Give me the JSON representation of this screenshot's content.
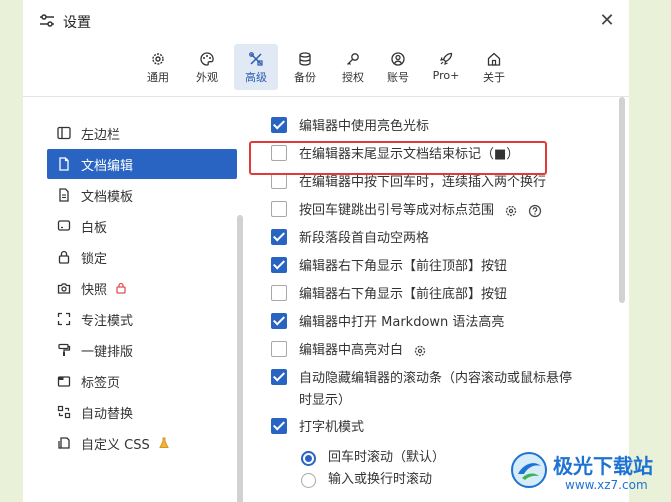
{
  "window": {
    "title": "设置"
  },
  "tabs": [
    {
      "label": "通用",
      "icon": "gear-icon"
    },
    {
      "label": "外观",
      "icon": "palette-icon"
    },
    {
      "label": "高级",
      "icon": "tools-icon",
      "active": true
    },
    {
      "label": "备份",
      "icon": "database-icon"
    },
    {
      "label": "授权",
      "icon": "key-icon"
    },
    {
      "label": "账号",
      "icon": "user-icon"
    },
    {
      "label": "Pro+",
      "icon": "rocket-icon"
    },
    {
      "label": "关于",
      "icon": "home-icon"
    }
  ],
  "sidebar": {
    "items": [
      {
        "label": "左边栏",
        "icon": "sidebar-icon"
      },
      {
        "label": "文档编辑",
        "icon": "document-icon",
        "active": true
      },
      {
        "label": "文档模板",
        "icon": "template-icon"
      },
      {
        "label": "白板",
        "icon": "whiteboard-icon"
      },
      {
        "label": "锁定",
        "icon": "lock-icon"
      },
      {
        "label": "快照",
        "icon": "camera-icon",
        "badge": "lock-badge-icon"
      },
      {
        "label": "专注模式",
        "icon": "focus-icon"
      },
      {
        "label": "一键排版",
        "icon": "brush-icon"
      },
      {
        "label": "标签页",
        "icon": "tab-icon"
      },
      {
        "label": "自动替换",
        "icon": "replace-icon"
      },
      {
        "label": "自定义 CSS",
        "icon": "css-icon",
        "badge": "flask-icon"
      }
    ]
  },
  "options": [
    {
      "label": "编辑器中使用亮色光标",
      "checked": true
    },
    {
      "label": "在编辑器末尾显示文档结束标记（■）",
      "checked": false
    },
    {
      "label": "在编辑器中按下回车时，连续插入两个换行",
      "checked": false
    },
    {
      "label": "按回车键跳出引号等成对标点范围",
      "checked": false
    },
    {
      "label": "新段落段首自动空两格",
      "checked": true
    },
    {
      "label": "编辑器右下角显示【前往顶部】按钮",
      "checked": true
    },
    {
      "label": "编辑器右下角显示【前往底部】按钮",
      "checked": false
    },
    {
      "label": "编辑器中打开 Markdown 语法高亮",
      "checked": true
    },
    {
      "label": "编辑器中高亮对白",
      "checked": false
    },
    {
      "label": "自动隐藏编辑器的滚动条（内容滚动或鼠标悬停",
      "label2": "时显示）",
      "checked": true
    },
    {
      "label": "打字机模式",
      "checked": true
    }
  ],
  "typewriter": {
    "radios": [
      {
        "label": "回车时滚动（默认）",
        "selected": true
      },
      {
        "label": "输入或换行时滚动",
        "selected": false
      }
    ]
  },
  "watermark": {
    "title": "极光下载站",
    "url": "www.xz7.com"
  },
  "colors": {
    "accent": "#2a64c3",
    "highlight": "#e23a3a",
    "background": "#e9f1d8"
  }
}
